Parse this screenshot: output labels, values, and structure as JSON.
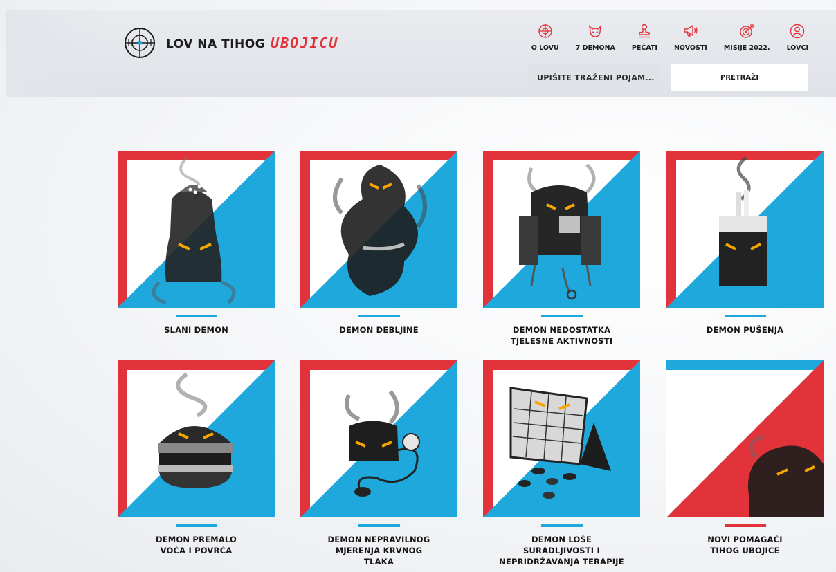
{
  "logo": {
    "text": "LOV NA TIHOG",
    "accent": "UBOJICU"
  },
  "nav": [
    {
      "label": "O LOVU",
      "icon": "crosshair-icon"
    },
    {
      "label": "7 DEMONA",
      "icon": "demon-face-icon"
    },
    {
      "label": "PEČATI",
      "icon": "stamp-icon"
    },
    {
      "label": "NOVOSTI",
      "icon": "megaphone-icon"
    },
    {
      "label": "MISIJE 2022.",
      "icon": "target-icon"
    },
    {
      "label": "LOVCI",
      "icon": "hunter-icon"
    }
  ],
  "search": {
    "placeholder": "UPIŠITE TRAŽENI POJAM...",
    "button_label": "PRETRAŽI"
  },
  "demons": [
    {
      "title": "SLANI DEMON",
      "shape": "salt-shaker"
    },
    {
      "title": "DEMON DEBLJINE",
      "shape": "ghost"
    },
    {
      "title": "DEMON NEDOSTATKA\nTJELESNE AKTIVNOSTI",
      "shape": "armchair"
    },
    {
      "title": "DEMON PUŠENJA",
      "shape": "cigarette-pack"
    },
    {
      "title": "DEMON PREMALO\nVOĆA I POVRĆA",
      "shape": "burger"
    },
    {
      "title": "DEMON NEPRAVILNOG\nMJERENJA KRVNOG\nTLAKA",
      "shape": "blood-pressure-cuff"
    },
    {
      "title": "DEMON LOŠE\nSURADLJIVOSTI I\nNEPRIDRŽAVANJA TERAPIJE",
      "shape": "calendar-pills"
    },
    {
      "title": "NOVI POMAGAČI\nTIHOG UBOJICE",
      "shape": "shadow-helper"
    }
  ],
  "colors": {
    "red": "#e2333a",
    "blue": "#1ea8dc",
    "white": "#ffffff"
  }
}
